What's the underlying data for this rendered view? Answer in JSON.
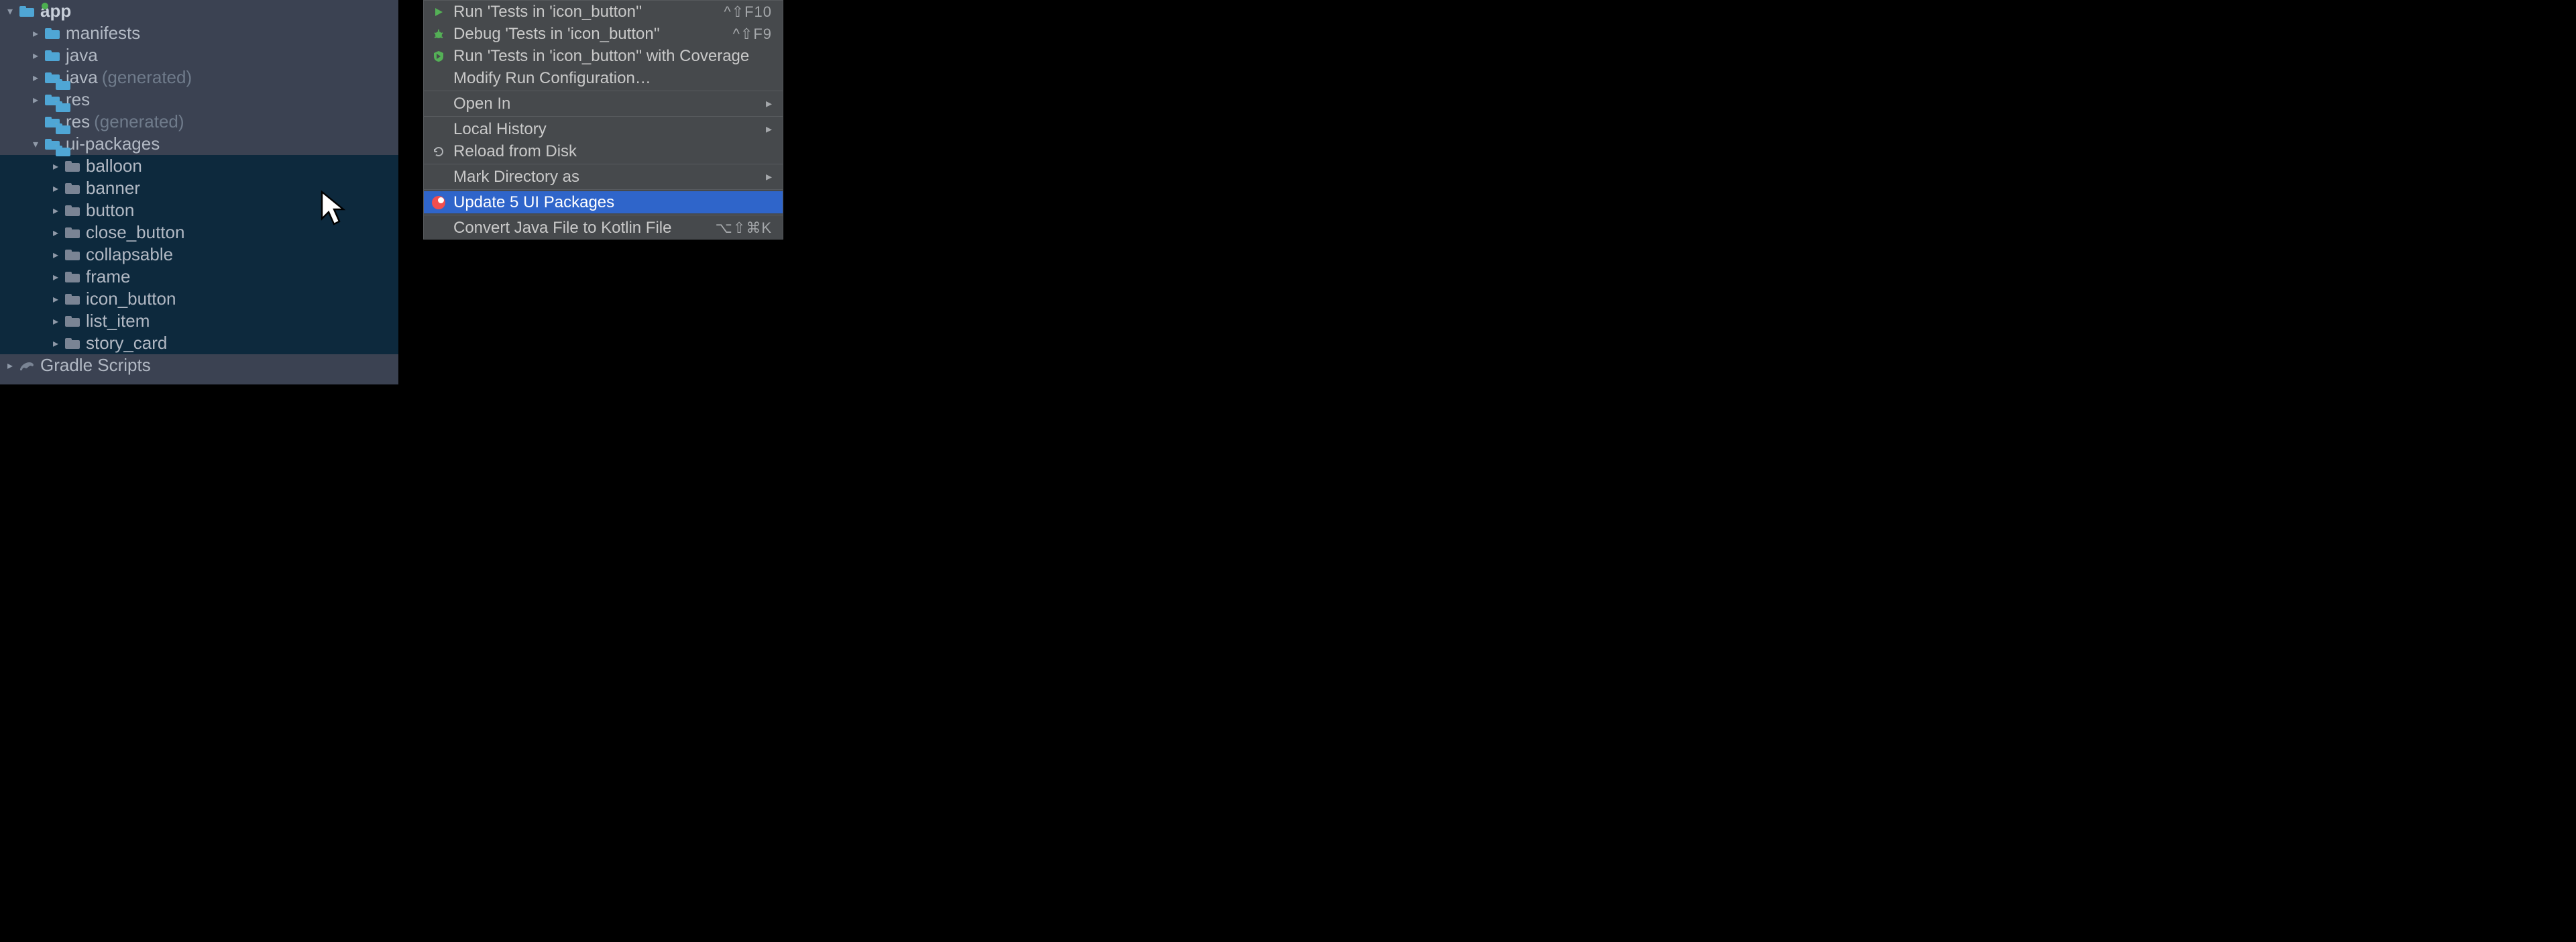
{
  "tree": {
    "app": {
      "label": "app"
    },
    "manifests": {
      "label": "manifests"
    },
    "java": {
      "label": "java"
    },
    "java_gen_label": "java",
    "java_gen_suffix": "(generated)",
    "res": {
      "label": "res"
    },
    "res_gen_label": "res",
    "res_gen_suffix": "(generated)",
    "uipackages": {
      "label": "ui-packages"
    },
    "items": [
      "balloon",
      "banner",
      "button",
      "close_button",
      "collapsable",
      "frame",
      "icon_button",
      "list_item",
      "story_card"
    ],
    "gradle": {
      "label": "Gradle Scripts"
    }
  },
  "menu": {
    "run": {
      "label": "Run 'Tests in 'icon_button''",
      "shortcut": "^⇧F10"
    },
    "debug": {
      "label": "Debug 'Tests in 'icon_button''",
      "shortcut": "^⇧F9"
    },
    "coverage": {
      "label": "Run 'Tests in 'icon_button'' with Coverage"
    },
    "modify": {
      "label": "Modify Run Configuration…"
    },
    "open_in": {
      "label": "Open In"
    },
    "local_history": {
      "label": "Local History"
    },
    "reload": {
      "label": "Reload from Disk"
    },
    "mark_dir": {
      "label": "Mark Directory as"
    },
    "update": {
      "label": "Update 5 UI Packages"
    },
    "convert": {
      "label": "Convert Java File to Kotlin File",
      "shortcut": "⌥⇧⌘K"
    }
  }
}
